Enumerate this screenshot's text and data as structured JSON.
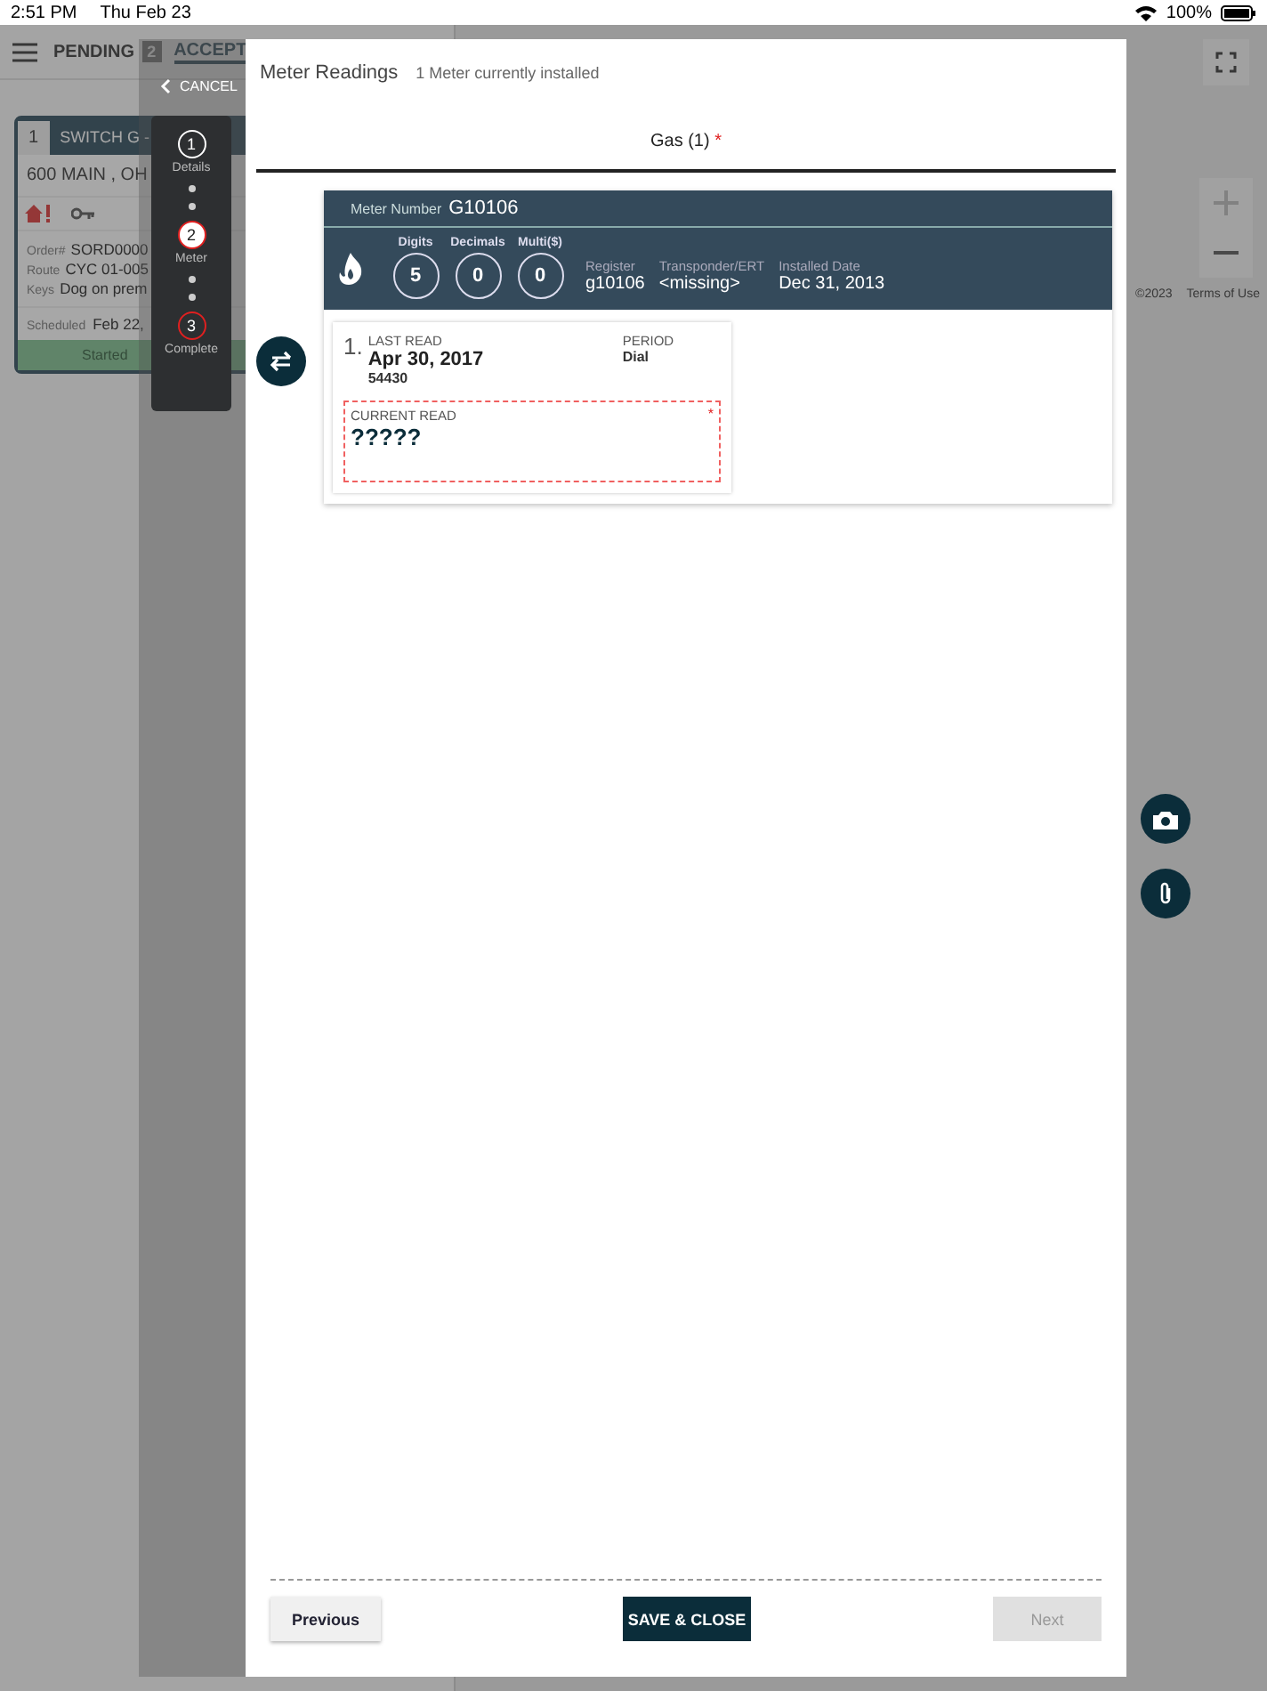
{
  "status_bar": {
    "time": "2:51 PM",
    "date": "Thu Feb 23",
    "battery": "100%"
  },
  "header": {
    "tabs": [
      {
        "label": "PENDING",
        "count": "2",
        "selected": false
      },
      {
        "label": "ACCEPT",
        "selected": true
      }
    ]
  },
  "work_order": {
    "number": "1",
    "title": "SWITCH G -",
    "address": "600 MAIN , OH",
    "fields": [
      {
        "label": "Order#",
        "value": "SORD0000"
      },
      {
        "label": "Route",
        "value": "CYC 01-005"
      },
      {
        "label": "Keys",
        "value": "Dog on prem"
      }
    ],
    "scheduled_label": "Scheduled",
    "scheduled_value": "Feb 22,",
    "status": "Started"
  },
  "map": {
    "copyright": "©2023",
    "terms": "Terms of Use"
  },
  "cancel": "CANCEL",
  "steps": [
    {
      "number": "1",
      "label": "Details",
      "done": true,
      "selected": false
    },
    {
      "number": "2",
      "label": "Meter",
      "done": false,
      "selected": true
    },
    {
      "number": "3",
      "label": "Complete",
      "done": false,
      "selected": false
    }
  ],
  "modal": {
    "title": "Meter Readings",
    "subtitle": "1 Meter currently installed",
    "tabs": [
      {
        "label": "Gas (1)",
        "required_mark": "*",
        "selected": true
      }
    ],
    "meter": {
      "number_label": "Meter Number",
      "number": "G10106",
      "dials": [
        {
          "label": "Digits",
          "value": "5"
        },
        {
          "label": "Decimals",
          "value": "0"
        },
        {
          "label": "Multi($)",
          "value": "0"
        }
      ],
      "info": [
        {
          "label": "Register",
          "value": "g10106"
        },
        {
          "label": "Transponder/ERT",
          "value": "<missing>"
        },
        {
          "label": "Installed Date",
          "value": "Dec 31, 2013"
        }
      ]
    },
    "reads": [
      {
        "index": "1.",
        "last_read_label": "LAST READ",
        "last_read_date": "Apr 30, 2017",
        "last_read_value": "54430",
        "period_label": "PERIOD",
        "period": "Dial",
        "current_label": "CURRENT READ",
        "current_value": "?????",
        "required": true,
        "required_mark": "*"
      }
    ],
    "buttons": {
      "previous": "Previous",
      "save": "SAVE & CLOSE",
      "next": "Next",
      "next_disabled": true
    }
  }
}
